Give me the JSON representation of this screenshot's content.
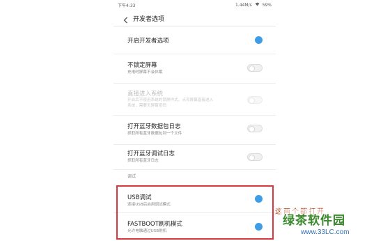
{
  "status_bar": {
    "time": "下午4:33",
    "network": "1.44M/s",
    "battery": "59%"
  },
  "header": {
    "title": "开发者选项"
  },
  "rows": [
    {
      "title": "开启开发者选项",
      "subtitle": "",
      "toggle": "on"
    },
    {
      "title": "不锁定屏幕",
      "subtitle": "充电时屏幕不会休眠",
      "toggle": "off"
    },
    {
      "title": "直接进入系统",
      "subtitle": "开启后不使用系统的锁屏样式，点亮屏幕直接进入\n系统，需要无屏幕密码",
      "toggle": "disabled-off"
    },
    {
      "title": "打开蓝牙数据包日志",
      "subtitle": "抓取所有蓝牙数据包到一个文件",
      "toggle": "off"
    },
    {
      "title": "打开蓝牙调试日志",
      "subtitle": "抓取所有蓝牙日志",
      "toggle": "off"
    }
  ],
  "debug_section": {
    "header": "调试",
    "rows": [
      {
        "title": "USB调试",
        "subtitle": "连接USB后启用调试模式",
        "toggle": "on"
      },
      {
        "title": "FASTBOOT刷机模式",
        "subtitle": "允许电脑通过USB刷机",
        "toggle": "on"
      }
    ]
  },
  "annotation": {
    "text": "这两个都打开"
  },
  "watermark": {
    "logo": "绿茶软件园",
    "url": "www.33LC.com"
  },
  "colors": {
    "accent": "#3d9ee6",
    "highlight": "#d9363e"
  }
}
